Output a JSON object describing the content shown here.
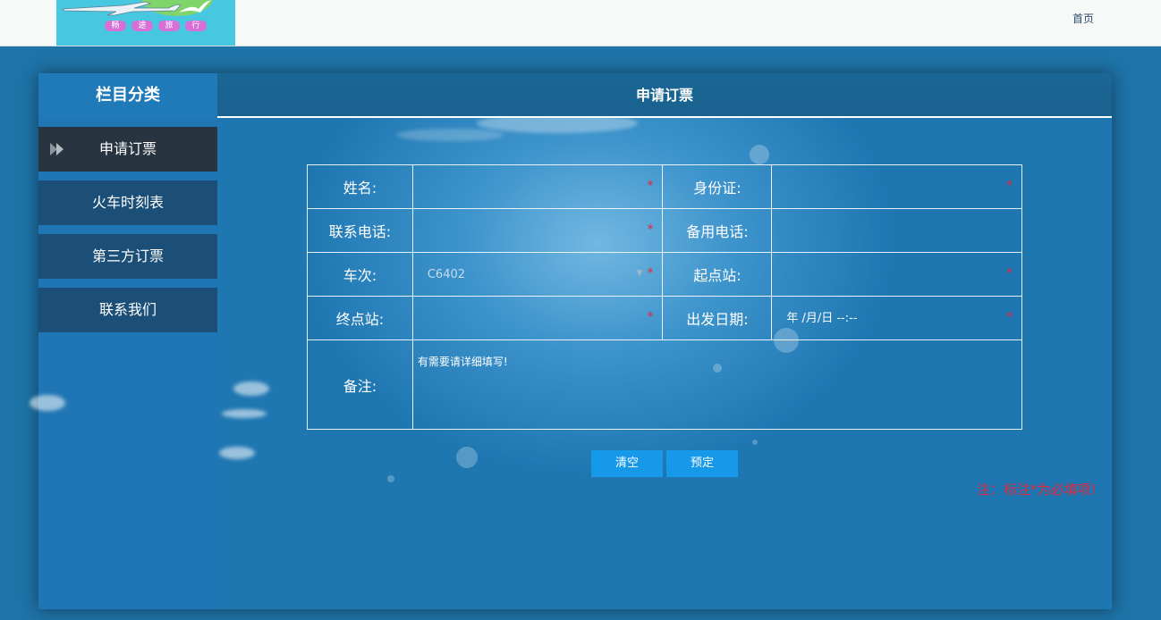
{
  "header": {
    "logo_text": [
      "畅",
      "途",
      "旅",
      "行"
    ],
    "home_link": "首页"
  },
  "sidebar": {
    "title": "栏目分类",
    "items": [
      {
        "label": "申请订票",
        "active": true
      },
      {
        "label": "火车时刻表",
        "active": false
      },
      {
        "label": "第三方订票",
        "active": false
      },
      {
        "label": "联系我们",
        "active": false
      }
    ]
  },
  "main": {
    "title": "申请订票",
    "form": {
      "name_label": "姓名:",
      "id_label": "身份证:",
      "phone_label": "联系电话:",
      "alt_phone_label": "备用电话:",
      "train_label": "车次:",
      "train_value": "C6402",
      "from_label": "起点站:",
      "to_label": "终点站:",
      "date_label": "出发日期:",
      "date_placeholder": "年 /月/日 --:--",
      "remark_label": "备注:",
      "remark_value": "有需要请详细填写!",
      "required_mark": "*"
    },
    "buttons": {
      "clear": "清空",
      "book": "预定"
    },
    "note": "注：标注*为必填项!"
  },
  "colors": {
    "accent": "#1599e8",
    "required": "#e1253a",
    "sidebar_active": "#283440",
    "sidebar_item": "#1b4f78"
  }
}
